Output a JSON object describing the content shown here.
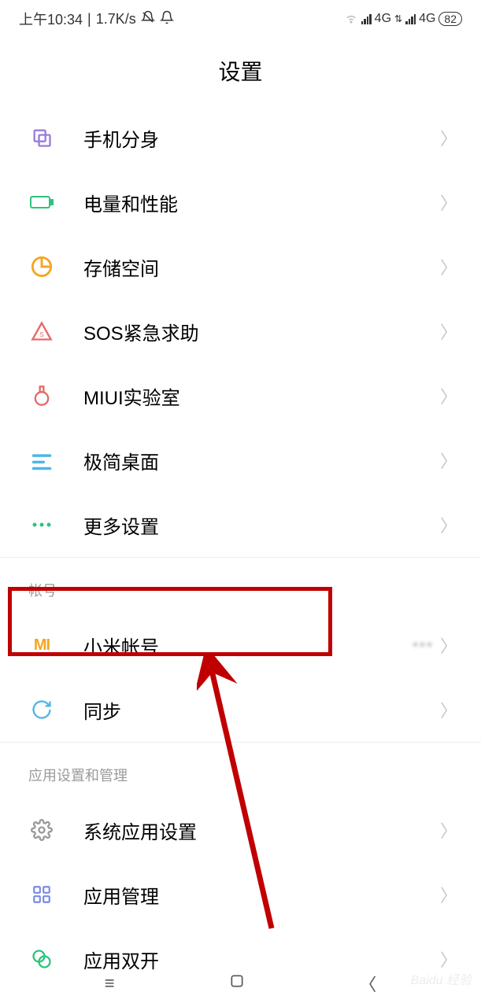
{
  "status": {
    "time": "上午10:34",
    "speed": "1.7K/s",
    "net1": "4G",
    "net2": "4G",
    "battery": "82"
  },
  "header": {
    "title": "设置"
  },
  "sections": {
    "main": [
      {
        "id": "phone-clone",
        "label": "手机分身",
        "iconColor": "#9b7bd8"
      },
      {
        "id": "battery-perf",
        "label": "电量和性能",
        "iconColor": "#2fc27d"
      },
      {
        "id": "storage",
        "label": "存储空间",
        "iconColor": "#f5a623"
      },
      {
        "id": "sos",
        "label": "SOS紧急求助",
        "iconColor": "#e46a6a"
      },
      {
        "id": "miui-lab",
        "label": "MIUI实验室",
        "iconColor": "#e46a6a"
      },
      {
        "id": "simple-desktop",
        "label": "极简桌面",
        "iconColor": "#4fb7e3"
      },
      {
        "id": "more-settings",
        "label": "更多设置",
        "iconColor": "#2fc27d"
      }
    ],
    "accountHeader": "帐号",
    "account": [
      {
        "id": "mi-account",
        "label": "小米帐号",
        "value": "•••",
        "iconColor": "#f5a623"
      },
      {
        "id": "sync",
        "label": "同步",
        "iconColor": "#4fb7e3"
      }
    ],
    "appsHeader": "应用设置和管理",
    "apps": [
      {
        "id": "system-apps",
        "label": "系统应用设置",
        "iconColor": "#9a9a9a"
      },
      {
        "id": "app-manage",
        "label": "应用管理",
        "iconColor": "#7b8ae0"
      },
      {
        "id": "app-dual",
        "label": "应用双开",
        "iconColor": "#2fc27d"
      }
    ]
  },
  "watermark": "Baidu 经验"
}
